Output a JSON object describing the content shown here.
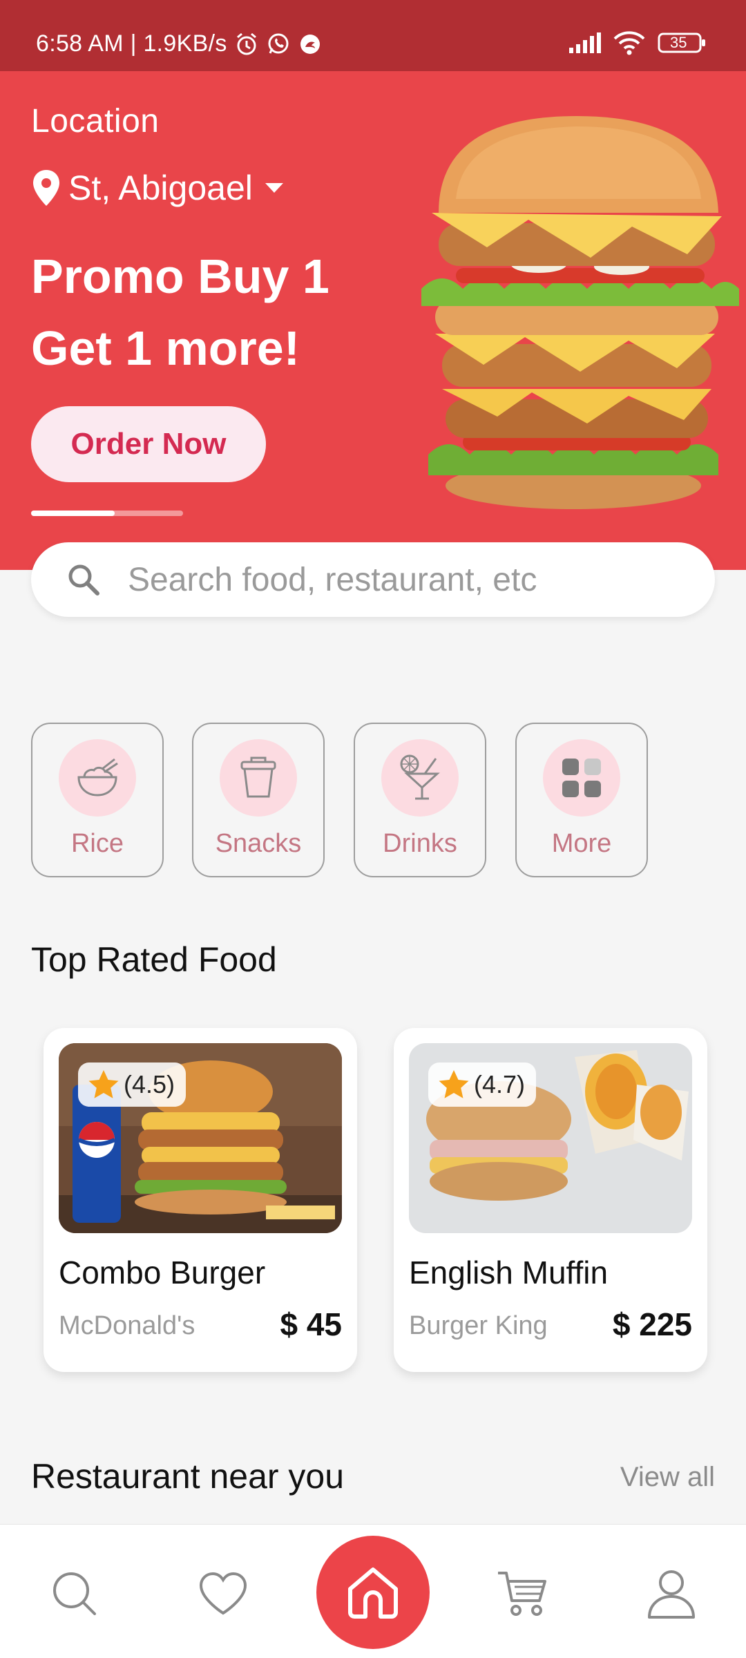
{
  "status_bar": {
    "time_speed": "6:58 AM | 1.9KB/s",
    "battery": "35"
  },
  "hero": {
    "location_label": "Location",
    "location_value": "St, Abigoael",
    "promo_line1": "Promo Buy 1",
    "promo_line2": "Get 1 more!",
    "order_button": "Order Now",
    "carousel_progress": 0.55
  },
  "search": {
    "placeholder": "Search food, restaurant, etc"
  },
  "categories": [
    {
      "label": "Rice",
      "icon": "rice-bowl-icon"
    },
    {
      "label": "Snacks",
      "icon": "cup-icon"
    },
    {
      "label": "Drinks",
      "icon": "cocktail-icon"
    },
    {
      "label": "More",
      "icon": "grid-icon"
    }
  ],
  "top_rated": {
    "title": "Top Rated Food",
    "items": [
      {
        "rating": "(4.5)",
        "name": "Combo Burger",
        "restaurant": "McDonald's",
        "price": "$ 45"
      },
      {
        "rating": "(4.7)",
        "name": "English Muffin",
        "restaurant": "Burger King",
        "price": "$ 225"
      }
    ]
  },
  "nearby": {
    "title": "Restaurant near you",
    "view_all": "View all"
  },
  "bottom_nav": [
    "search-icon",
    "heart-icon",
    "home-icon",
    "cart-icon",
    "profile-icon"
  ],
  "colors": {
    "status_bar": "#b12e33",
    "hero_bg": "#e9454a",
    "accent": "#ec4449",
    "category_label": "#c47683",
    "category_circle": "#fcdbe1",
    "star": "#f7a21b"
  }
}
